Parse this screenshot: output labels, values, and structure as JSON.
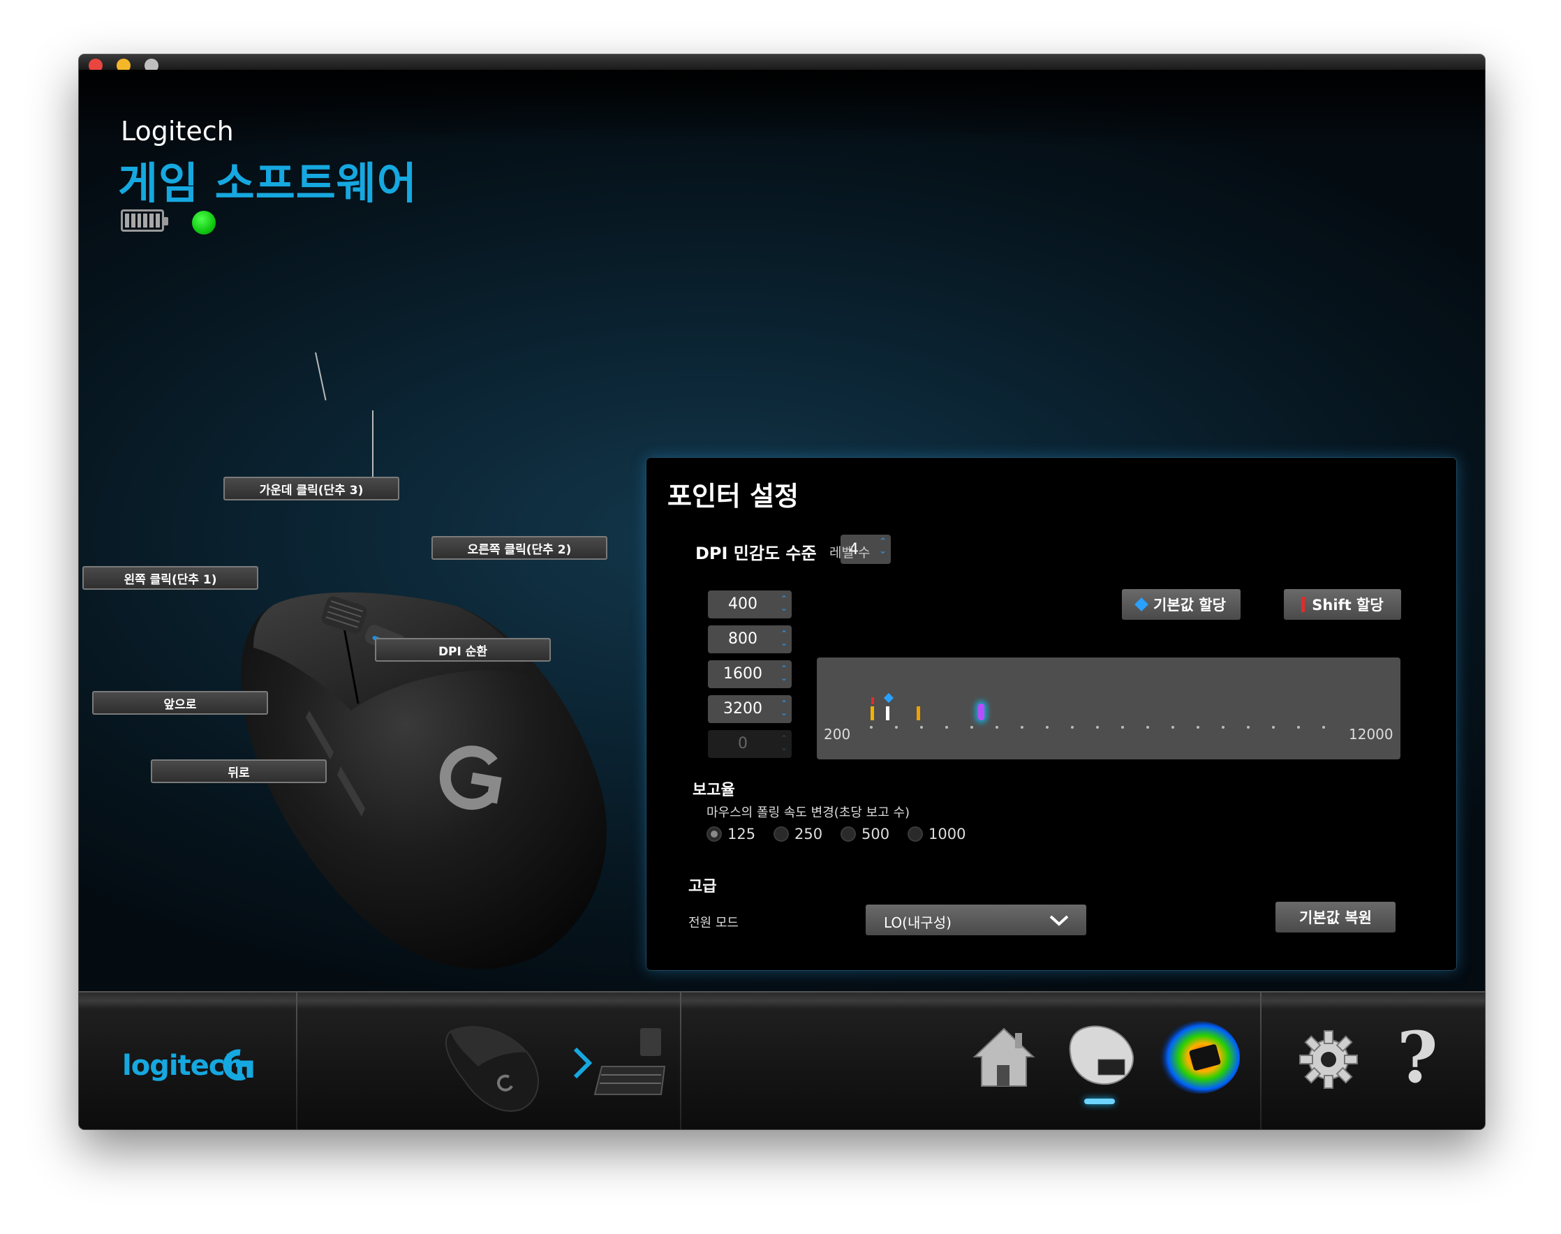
{
  "window": {
    "traffic_lights": [
      "close",
      "minimize",
      "zoom"
    ]
  },
  "header": {
    "brand": "Logitech",
    "product": "게임 소프트웨어",
    "battery_icon": "battery-icon",
    "status_color": "#11c811"
  },
  "mouse_labels": {
    "middle": "가운데 클릭(단추 3)",
    "right": "오른쪽 클릭(단추 2)",
    "left": "왼쪽 클릭(단추 1)",
    "dpi": "DPI 순환",
    "forward": "앞으로",
    "back": "뒤로"
  },
  "panel": {
    "title": "포인터 설정",
    "dpi_label": "DPI 민감도 수준",
    "levels_value": "4",
    "levels_suffix": "레벨 수",
    "dpi_values": [
      "400",
      "800",
      "1600",
      "3200",
      "0"
    ],
    "default_button": "기본값 할당",
    "shift_button": "Shift 할당",
    "scale_min": "200",
    "scale_max": "12000",
    "report_title": "보고율",
    "report_sub": "마우스의 폴링 속도 변경(초당 보고 수)",
    "report_options": [
      "125",
      "250",
      "500",
      "1000"
    ],
    "report_selected": "125",
    "advanced_title": "고급",
    "power_label": "전원 모드",
    "power_value": "LO(내구성)",
    "restore_button": "기본값 복원"
  },
  "bottom": {
    "logo_text": "logitech",
    "icons": [
      "mouse-device-icon",
      "keyboard-device-icon",
      "home-icon",
      "pointer-settings-icon",
      "heatmap-icon",
      "gear-icon",
      "help-icon"
    ]
  },
  "colors": {
    "accent": "#16a8e0",
    "panel_bg": "#000000",
    "track": "#4e4e4e"
  }
}
